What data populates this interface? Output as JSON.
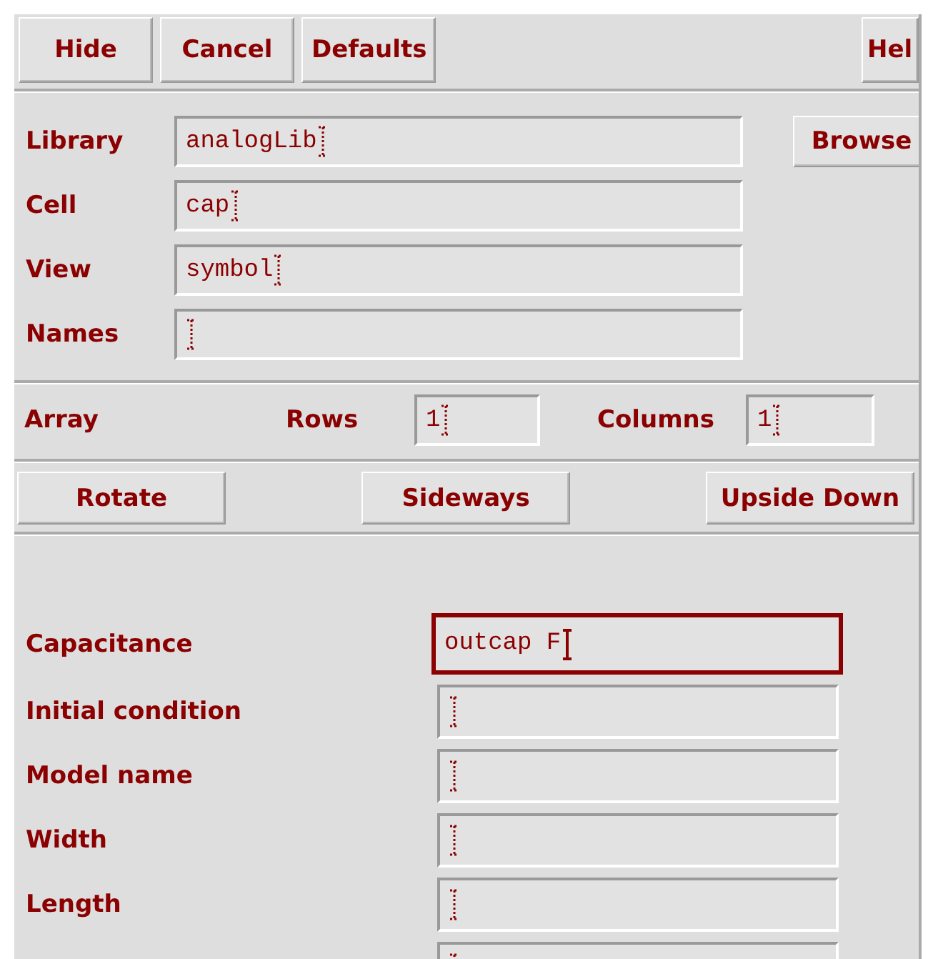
{
  "toolbar": [
    "Hide",
    "Cancel",
    "Defaults",
    "Hel"
  ],
  "cell_fields": [
    {
      "label": "Library",
      "value": "analogLib"
    },
    {
      "label": "Cell",
      "value": "cap"
    },
    {
      "label": "View",
      "value": "symbol"
    },
    {
      "label": "Names"
    }
  ],
  "browse_button": "Browse",
  "array": {
    "label": "Array",
    "rows_label": "Rows",
    "rows_value": "1",
    "columns_label": "Columns",
    "columns_value": "1"
  },
  "orientation_buttons": [
    "Rotate",
    "Sideways",
    "Upside Down"
  ],
  "parameters": [
    {
      "label": "Capacitance",
      "value": "outcap F",
      "focused": true
    },
    {
      "label": "Initial condition",
      "focused": false
    },
    {
      "label": "Model name",
      "focused": false
    },
    {
      "label": "Width",
      "focused": false
    },
    {
      "label": "Length",
      "focused": false
    },
    {
      "focused": false
    }
  ]
}
